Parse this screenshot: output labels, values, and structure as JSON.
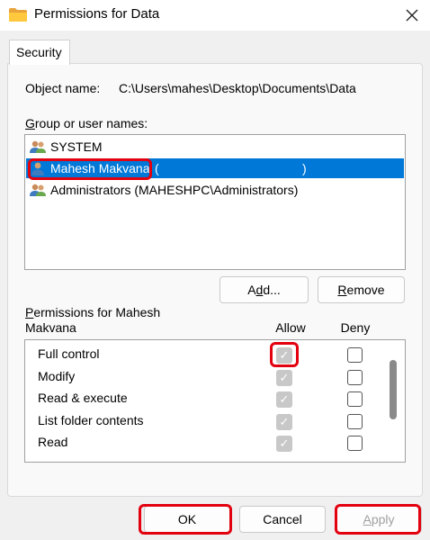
{
  "window": {
    "title": "Permissions for Data",
    "close_icon": "close-icon"
  },
  "tabs": [
    {
      "label": "Security"
    }
  ],
  "object": {
    "label": "Object name:",
    "value": "C:\\Users\\mahes\\Desktop\\Documents\\Data"
  },
  "users": {
    "label": "Group or user names:",
    "items": [
      {
        "label": "SYSTEM",
        "icon": "group-users-icon"
      },
      {
        "label": "Mahesh Makvana",
        "suffix_open": "(",
        "suffix_close": ")",
        "icon": "user-icon"
      },
      {
        "label": "Administrators (MAHESHPC\\Administrators)",
        "icon": "group-users-icon"
      }
    ],
    "selected_index": 1
  },
  "buttons": {
    "add": "Add...",
    "remove": "Remove",
    "ok": "OK",
    "cancel": "Cancel",
    "apply": "Apply"
  },
  "permissions": {
    "label": "Permissions for Mahesh Makvana",
    "allow_header": "Allow",
    "deny_header": "Deny",
    "items": [
      {
        "name": "Full control",
        "allow": true,
        "deny": false
      },
      {
        "name": "Modify",
        "allow": true,
        "deny": false
      },
      {
        "name": "Read & execute",
        "allow": true,
        "deny": false
      },
      {
        "name": "List folder contents",
        "allow": true,
        "deny": false
      },
      {
        "name": "Read",
        "allow": true,
        "deny": false
      },
      {
        "name": "",
        "allow": true,
        "deny": false
      }
    ]
  },
  "colors": {
    "selection": "#0078d7",
    "highlight": "#e3000f"
  }
}
